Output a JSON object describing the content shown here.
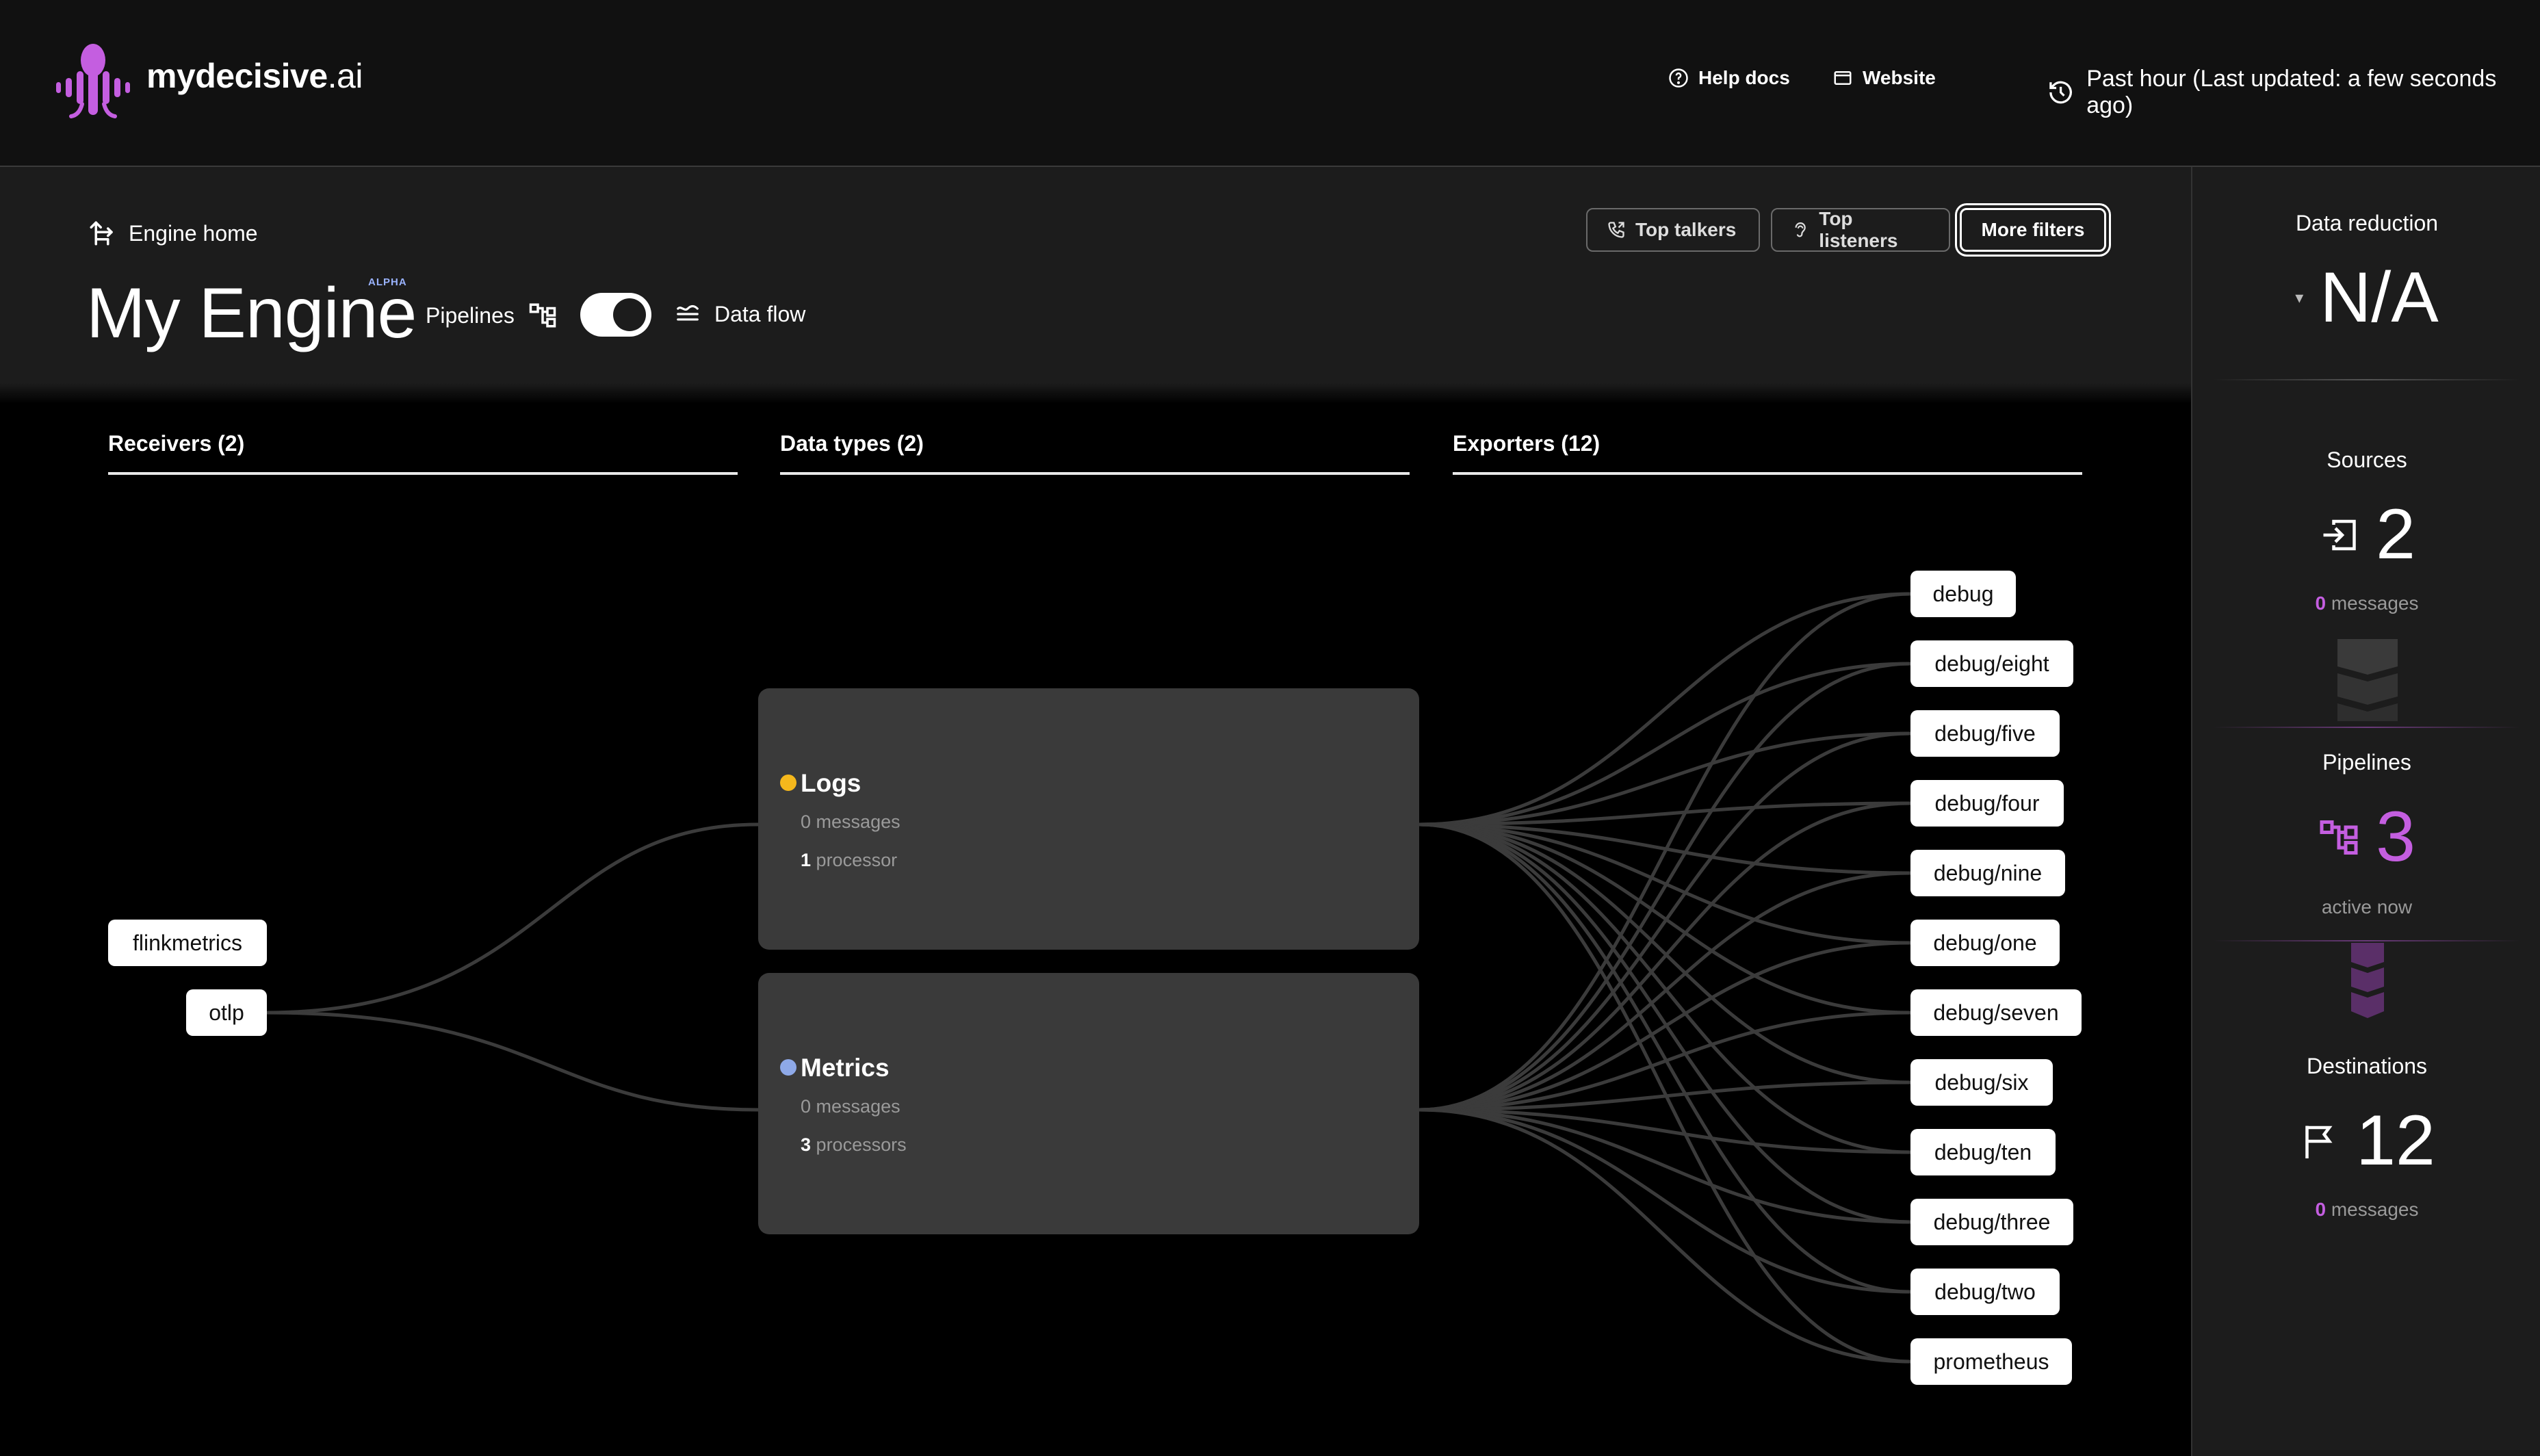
{
  "brand": {
    "name": "mydecisive",
    "suffix": ".ai"
  },
  "topbar": {
    "help_docs": "Help docs",
    "website": "Website",
    "time_range": "Past hour (Last updated: a few seconds ago)"
  },
  "engine": {
    "home_label": "Engine home",
    "title": "My Engine",
    "badge": "ALPHA",
    "pipelines_label": "Pipelines",
    "dataflow_label": "Data flow",
    "view_toggle_on": true
  },
  "filters": {
    "top_talkers": "Top talkers",
    "top_listeners": "Top listeners",
    "more_filters": "More filters"
  },
  "columns": {
    "receivers": "Receivers (2)",
    "data_types": "Data types (2)",
    "exporters": "Exporters (12)"
  },
  "receivers": [
    "flinkmetrics",
    "otlp"
  ],
  "data_types": [
    {
      "name": "Logs",
      "messages_count": "0",
      "messages_label": "messages",
      "processors_count": "1",
      "processors_label": "processor",
      "color": "#f5b81c"
    },
    {
      "name": "Metrics",
      "messages_count": "0",
      "messages_label": "messages",
      "processors_count": "3",
      "processors_label": "processors",
      "color": "#8ea9e8"
    }
  ],
  "exporters": [
    "debug",
    "debug/eight",
    "debug/five",
    "debug/four",
    "debug/nine",
    "debug/one",
    "debug/seven",
    "debug/six",
    "debug/ten",
    "debug/three",
    "debug/two",
    "prometheus"
  ],
  "summary": {
    "data_reduction": {
      "title": "Data reduction",
      "value": "N/A"
    },
    "sources": {
      "title": "Sources",
      "value": "2",
      "count": "0",
      "label": "messages"
    },
    "pipelines": {
      "title": "Pipelines",
      "value": "3",
      "label": "active now"
    },
    "destinations": {
      "title": "Destinations",
      "value": "12",
      "count": "0",
      "label": "messages"
    }
  },
  "colors": {
    "accent": "#c45ee0",
    "panel": "#1c1c1c",
    "node": "#3a3a3a"
  }
}
